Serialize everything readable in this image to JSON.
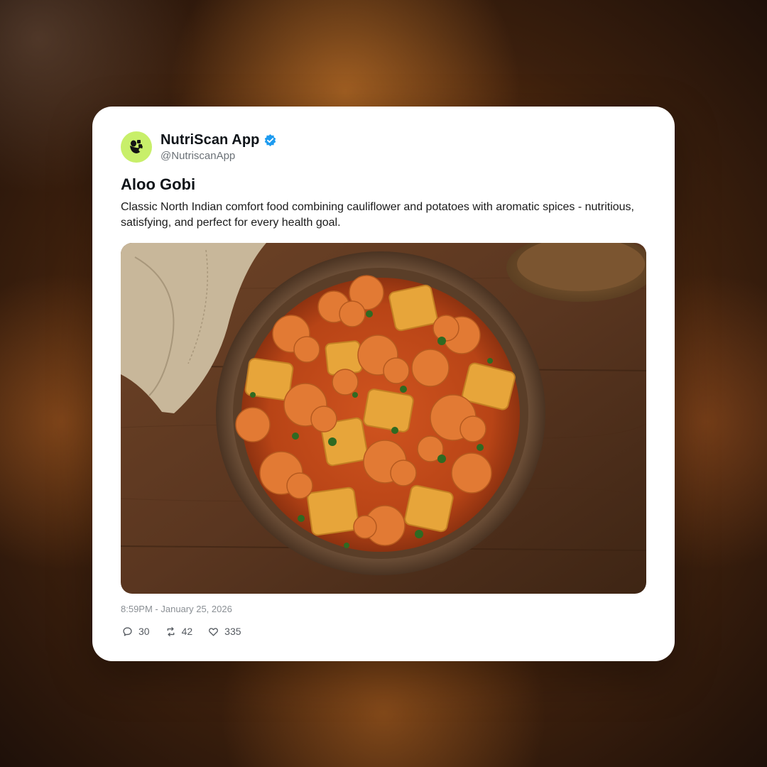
{
  "post": {
    "account_name": "NutriScan App",
    "handle": "@NutriscanApp",
    "verified": true,
    "title": "Aloo Gobi",
    "description": "Classic North Indian comfort food combining cauliflower and potatoes with aromatic spices - nutritious, satisfying, and perfect for every health goal.",
    "timestamp": "8:59PM - January 25, 2026",
    "image_icon": "food-photo",
    "stats": {
      "replies": "30",
      "reposts": "42",
      "likes": "335"
    }
  },
  "icons": {
    "avatar": "nutriscan-logo-icon",
    "verified": "verified-badge-icon",
    "reply": "comment-icon",
    "repost": "repost-icon",
    "like": "heart-icon"
  },
  "colors": {
    "avatar_bg": "#c8ef6a",
    "verified_blue": "#1d9bf0",
    "text_primary": "#0f1419",
    "text_muted": "#8a8f94"
  }
}
